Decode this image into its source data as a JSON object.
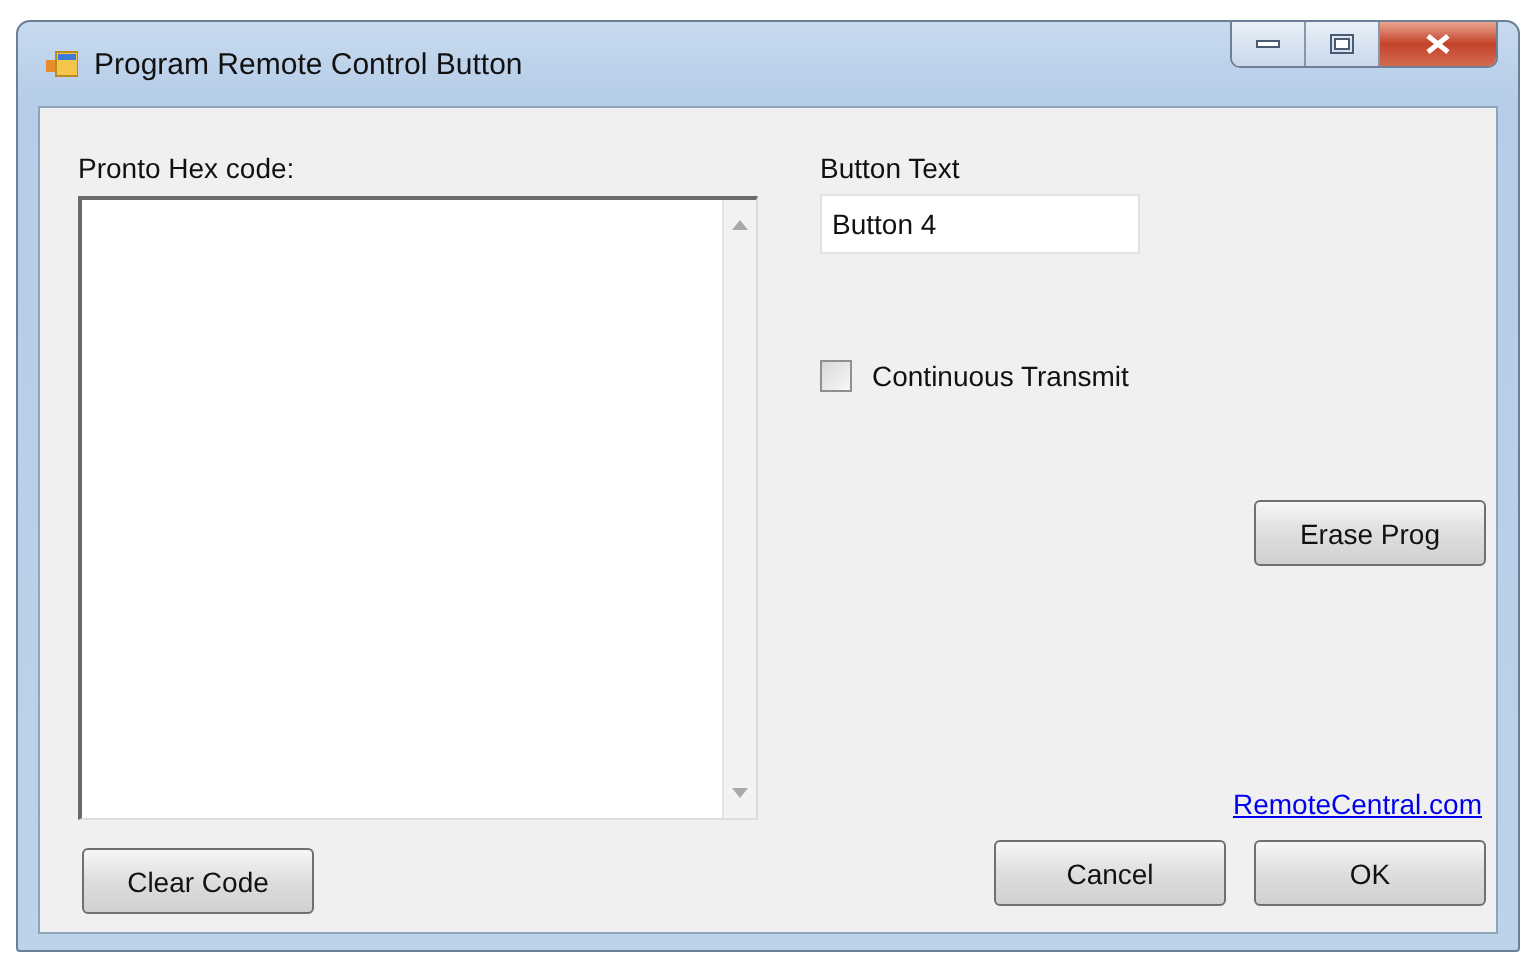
{
  "window": {
    "title": "Program Remote Control Button"
  },
  "hex_code": {
    "label": "Pronto Hex code:"
  },
  "button_text": {
    "label": "Button Text",
    "value": "Button 4"
  },
  "continuous_transmit": {
    "label": "Continuous Transmit",
    "checked": false
  },
  "buttons": [
    {
      "kind": "erase",
      "label": "Erase Prog"
    },
    {
      "kind": "clear",
      "label": "Clear Code"
    },
    {
      "kind": "cancel",
      "label": "Cancel"
    },
    {
      "kind": "ok",
      "label": "OK"
    }
  ],
  "link": {
    "text": "RemoteCentral.com"
  }
}
